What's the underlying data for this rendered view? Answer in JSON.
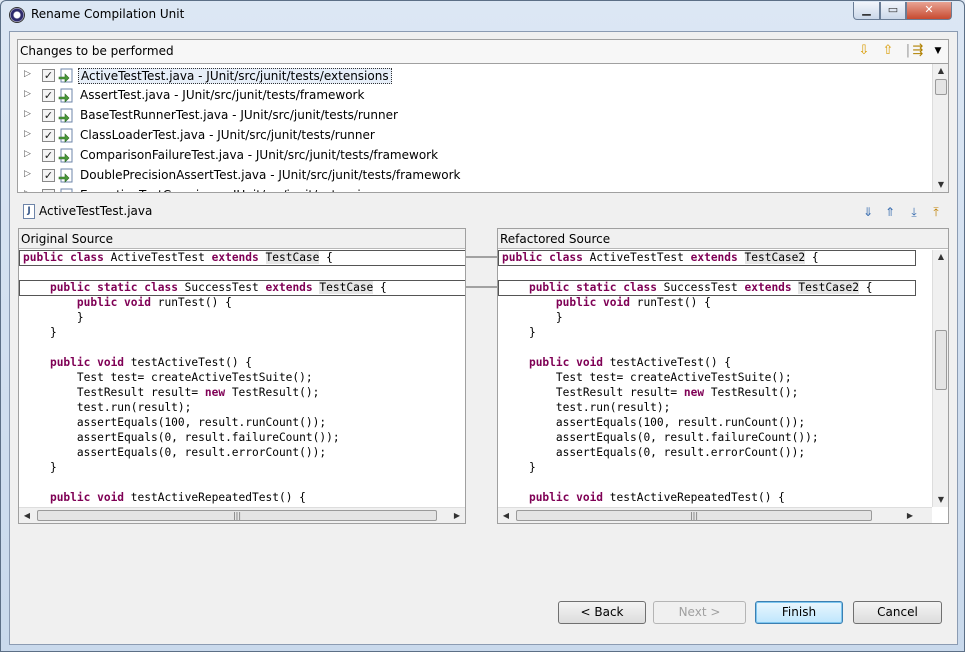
{
  "window": {
    "title": "Rename Compilation Unit",
    "min_label": "▁",
    "max_label": "▭",
    "close_label": "✕"
  },
  "changes": {
    "header": "Changes to be performed",
    "items": [
      {
        "label": "ActiveTestTest.java - JUnit/src/junit/tests/extensions",
        "checked": true,
        "selected": true
      },
      {
        "label": "AssertTest.java - JUnit/src/junit/tests/framework",
        "checked": true,
        "selected": false
      },
      {
        "label": "BaseTestRunnerTest.java - JUnit/src/junit/tests/runner",
        "checked": true,
        "selected": false
      },
      {
        "label": "ClassLoaderTest.java - JUnit/src/junit/tests/runner",
        "checked": true,
        "selected": false
      },
      {
        "label": "ComparisonFailureTest.java - JUnit/src/junit/tests/framework",
        "checked": true,
        "selected": false
      },
      {
        "label": "DoublePrecisionAssertTest.java - JUnit/src/junit/tests/framework",
        "checked": true,
        "selected": false
      },
      {
        "label": "ExceptionTestCase.java - JUnit/src/junit/extensions",
        "checked": true,
        "selected": false
      }
    ]
  },
  "compare": {
    "file": "ActiveTestTest.java",
    "original_title": "Original Source",
    "refactored_title": "Refactored Source",
    "original_lines": [
      [
        {
          "t": "public class",
          "k": 1
        },
        {
          "t": " ActiveTestTest "
        },
        {
          "t": "extends",
          "k": 1
        },
        {
          "t": " "
        },
        {
          "t": "TestCase",
          "h": 1
        },
        {
          "t": " {"
        }
      ],
      [],
      [
        {
          "t": "    "
        },
        {
          "t": "public static class",
          "k": 1
        },
        {
          "t": " SuccessTest "
        },
        {
          "t": "extends",
          "k": 1
        },
        {
          "t": " "
        },
        {
          "t": "TestCase",
          "h": 1
        },
        {
          "t": " {"
        }
      ],
      [
        {
          "t": "        "
        },
        {
          "t": "public void",
          "k": 1
        },
        {
          "t": " runTest() {"
        }
      ],
      [
        {
          "t": "        }"
        }
      ],
      [
        {
          "t": "    }"
        }
      ],
      [],
      [
        {
          "t": "    "
        },
        {
          "t": "public void",
          "k": 1
        },
        {
          "t": " testActiveTest() {"
        }
      ],
      [
        {
          "t": "        Test test= createActiveTestSuite();"
        }
      ],
      [
        {
          "t": "        TestResult result= "
        },
        {
          "t": "new",
          "k": 1
        },
        {
          "t": " TestResult();"
        }
      ],
      [
        {
          "t": "        test.run(result);"
        }
      ],
      [
        {
          "t": "        assertEquals(100, result.runCount());"
        }
      ],
      [
        {
          "t": "        assertEquals(0, result.failureCount());"
        }
      ],
      [
        {
          "t": "        assertEquals(0, result.errorCount());"
        }
      ],
      [
        {
          "t": "    }"
        }
      ],
      [],
      [
        {
          "t": "    "
        },
        {
          "t": "public void",
          "k": 1
        },
        {
          "t": " testActiveRepeatedTest() {"
        }
      ]
    ],
    "refactored_lines": [
      [
        {
          "t": "public class",
          "k": 1
        },
        {
          "t": " ActiveTestTest "
        },
        {
          "t": "extends",
          "k": 1
        },
        {
          "t": " "
        },
        {
          "t": "TestCase2",
          "h": 1
        },
        {
          "t": " {"
        }
      ],
      [],
      [
        {
          "t": "    "
        },
        {
          "t": "public static class",
          "k": 1
        },
        {
          "t": " SuccessTest "
        },
        {
          "t": "extends",
          "k": 1
        },
        {
          "t": " "
        },
        {
          "t": "TestCase2",
          "h": 1
        },
        {
          "t": " {"
        }
      ],
      [
        {
          "t": "        "
        },
        {
          "t": "public void",
          "k": 1
        },
        {
          "t": " runTest() {"
        }
      ],
      [
        {
          "t": "        }"
        }
      ],
      [
        {
          "t": "    }"
        }
      ],
      [],
      [
        {
          "t": "    "
        },
        {
          "t": "public void",
          "k": 1
        },
        {
          "t": " testActiveTest() {"
        }
      ],
      [
        {
          "t": "        Test test= createActiveTestSuite();"
        }
      ],
      [
        {
          "t": "        TestResult result= "
        },
        {
          "t": "new",
          "k": 1
        },
        {
          "t": " TestResult();"
        }
      ],
      [
        {
          "t": "        test.run(result);"
        }
      ],
      [
        {
          "t": "        assertEquals(100, result.runCount());"
        }
      ],
      [
        {
          "t": "        assertEquals(0, result.failureCount());"
        }
      ],
      [
        {
          "t": "        assertEquals(0, result.errorCount());"
        }
      ],
      [
        {
          "t": "    }"
        }
      ],
      [],
      [
        {
          "t": "    "
        },
        {
          "t": "public void",
          "k": 1
        },
        {
          "t": " testActiveRepeatedTest() {"
        }
      ]
    ]
  },
  "buttons": {
    "back": "< Back",
    "next": "Next >",
    "finish": "Finish",
    "cancel": "Cancel"
  },
  "colors": {
    "keyword": "#7f0055",
    "change_highlight": "#e6e6e6",
    "selection": "#e6eef8"
  }
}
